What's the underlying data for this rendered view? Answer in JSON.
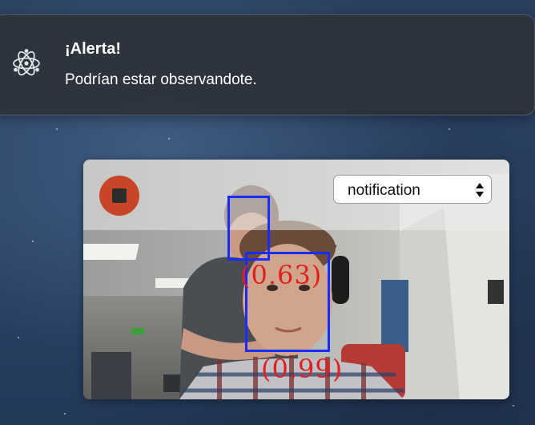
{
  "notification": {
    "title": "¡Alerta!",
    "message": "Podrían estar observandote.",
    "app_icon": "electron-atom-icon"
  },
  "camera": {
    "stop_icon": "stop-icon",
    "mode_select": {
      "value": "notification"
    },
    "detections": [
      {
        "confidence_label": "(0.63)"
      },
      {
        "confidence_label": "(0.99)"
      }
    ],
    "colors": {
      "stop_button": "#c94527",
      "face_box": "#1a2bff",
      "confidence_text": "#e02020"
    }
  }
}
